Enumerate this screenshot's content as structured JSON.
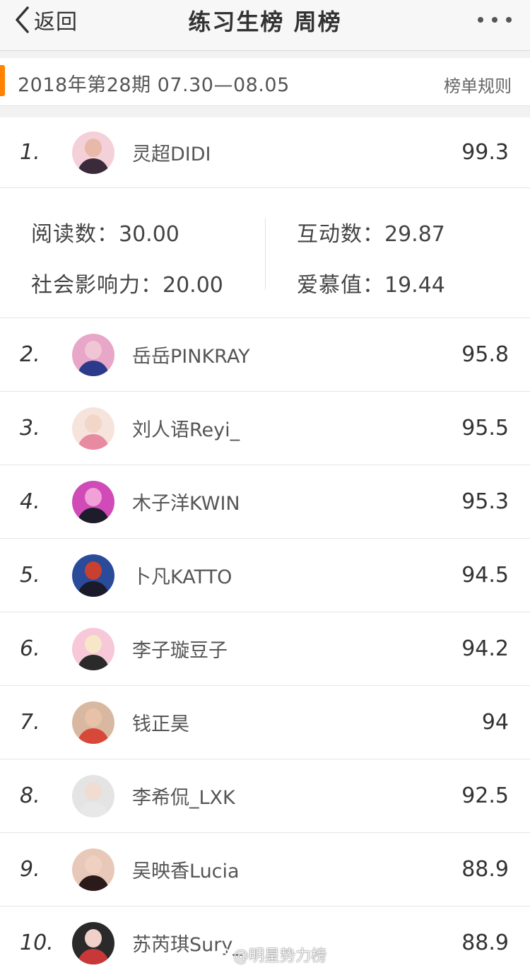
{
  "nav": {
    "back_label": "返回",
    "title": "练习生榜 周榜"
  },
  "period": {
    "text": "2018年第28期  07.30—08.05",
    "rules_label": "榜单规则",
    "accent_color": "#ff8200"
  },
  "ranking": [
    {
      "rank": "1.",
      "name": "灵超DIDI",
      "score": "99.3",
      "avatar_colors": [
        "#e8b8a8",
        "#3a2a3a",
        "#f4d0d8"
      ]
    },
    {
      "rank": "2.",
      "name": "岳岳PINKRAY",
      "score": "95.8",
      "avatar_colors": [
        "#f0c6d4",
        "#2b3a8a",
        "#e8a6c8"
      ]
    },
    {
      "rank": "3.",
      "name": "刘人语Reyi_",
      "score": "95.5",
      "avatar_colors": [
        "#f2d6c8",
        "#e88aa0",
        "#f6e4dc"
      ]
    },
    {
      "rank": "4.",
      "name": "木子洋KWIN",
      "score": "95.3",
      "avatar_colors": [
        "#f2a0d8",
        "#1c1c2a",
        "#d04ab8"
      ]
    },
    {
      "rank": "5.",
      "name": "卜凡KATTO",
      "score": "94.5",
      "avatar_colors": [
        "#c84030",
        "#1a1a2a",
        "#2a4a9a"
      ]
    },
    {
      "rank": "6.",
      "name": "李子璇豆子",
      "score": "94.2",
      "avatar_colors": [
        "#f8e6c8",
        "#2a2a2a",
        "#f6c8d8"
      ]
    },
    {
      "rank": "7.",
      "name": "钱正昊",
      "score": "94",
      "avatar_colors": [
        "#e8c2a8",
        "#d84838",
        "#d8b8a0"
      ]
    },
    {
      "rank": "8.",
      "name": "李希侃_LXK",
      "score": "92.5",
      "avatar_colors": [
        "#f0dcd0",
        "#e8e8e8",
        "#e4e4e4"
      ]
    },
    {
      "rank": "9.",
      "name": "吴映香Lucia",
      "score": "88.9",
      "avatar_colors": [
        "#f0d0c0",
        "#2a1a1a",
        "#e8c8b8"
      ]
    },
    {
      "rank": "10.",
      "name": "苏芮琪Sury_",
      "score": "88.9",
      "avatar_colors": [
        "#f0d0c8",
        "#c83838",
        "#2a2a2a"
      ]
    }
  ],
  "detail": {
    "reads_label": "阅读数：",
    "reads_value": "30.00",
    "interactions_label": "互动数：",
    "interactions_value": "29.87",
    "social_label": "社会影响力：",
    "social_value": "20.00",
    "love_label": "爱慕值：",
    "love_value": "19.44"
  },
  "watermark": "@明星势力榜"
}
